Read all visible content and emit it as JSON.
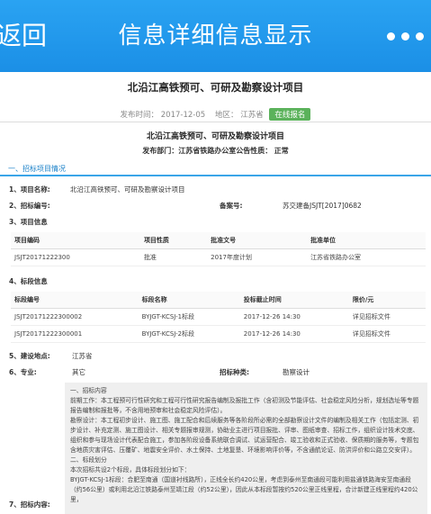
{
  "nav": {
    "back_label": "返回",
    "title": "信息详细信息显示"
  },
  "header": {
    "title": "北沿江高铁预可、可研及勘察设计项目",
    "publish_label": "发布时间：",
    "publish_date": "2017-12-05",
    "region_label": "地区：",
    "region": "江苏省",
    "online_button": "在线报名"
  },
  "notice": {
    "title": "北沿江高铁预可、可研及勘察设计项目",
    "dept_label": "发布部门：",
    "dept": "江苏省铁路办公室公告性质：",
    "nature": "正常"
  },
  "section": {
    "title": "一、招标项目情况"
  },
  "fields": {
    "name_label": "1、项目名称:",
    "name_value": "北沿江高铁预可、可研及勘察设计项目",
    "code_label": "2、招标编号:",
    "record_label": "备案号:",
    "record_value": "苏交建备JSJT[2017]0682",
    "info_label": "3、项目信息",
    "section_label": "4、标段信息",
    "location_label": "5、建设地点:",
    "location_value": "江苏省",
    "specialty_label": "6、专业:",
    "specialty_value": "其它",
    "type_label": "招标种类:",
    "type_value": "勘察设计",
    "content_label": "7、招标内容:"
  },
  "project_table": {
    "headers": [
      "项目编码",
      "项目性质",
      "批准文号",
      "批准单位"
    ],
    "rows": [
      [
        "JSJT20171222300",
        "批准",
        "2017年度计划",
        "江苏省铁路办公室"
      ]
    ]
  },
  "section_table": {
    "headers": [
      "标段编号",
      "标段名称",
      "投标截止时间",
      "限价/元"
    ],
    "rows": [
      [
        "JSJT20171222300002",
        "BYJGT-KCSJ-1标段",
        "2017-12-26 14:30",
        "详见招标文件"
      ],
      [
        "JSJT20171222300001",
        "BYJGT-KCSJ-2标段",
        "2017-12-26 14:30",
        "详见招标文件"
      ]
    ]
  },
  "content": {
    "lines": [
      "一、招标内容",
      "前期工作：本工程预可行性研究和工程可行性研究报告编制及报批工作（含初测及节能评估、社会稳定风险分析，规划选址等专题报告编制和报批等，不含用地预审和社会稳定风险评估）。",
      "勘察设计：本工程初步设计、施工图、施工配合和后续服务等各阶段所必需的全部勘察设计文件的编制及相关工作（包括定测、初步设计、补充定测、施工图设计、相关专题报审规测，协助业主进行项目报批、评审、图纸审查、招标工作，组织设计技术交底、组织和参与现场设计代表配合施工，参加各阶段设备系统联合调试、试运营配合、竣工验收和正式验收、保质期的服务等，专题包含地质灾害评估、压覆矿、地震安全评价、水土保持、土地复垦、环境影响评价等，不含通航论证、防洪评价和公路立交安评）。",
      "二、标段划分",
      "本次招标共设2个标段，具体标段划分如下：",
      "BYJGT-KCSJ-1标段：合肥至南通（国道衬线路所），正线全长约420公里，考虑到泰州至南通段可能利用盐通铁路海安至南通段（约56公里）或利用北沿江铁路泰州至靖江段（约52公里），因此从本标段暂按约520公里正线里程，合计新建正线里程约420公里，"
    ]
  }
}
